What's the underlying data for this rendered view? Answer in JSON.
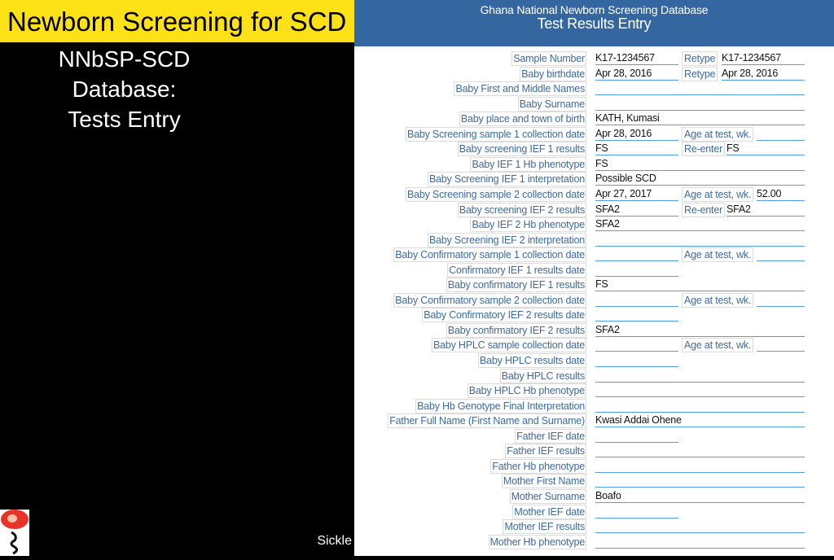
{
  "slide": {
    "title": "Newborn Screening for SCD",
    "subtitle_lines": [
      "NNbSP-SCD",
      "Database:",
      "Tests Entry"
    ],
    "footer_text": "Sickle",
    "logo_icon": "sickle-cell-logo-icon"
  },
  "form": {
    "header": {
      "line1": "Ghana National Newborn Screening Database",
      "line2": "Test Results Entry"
    },
    "rows": [
      {
        "label": "Sample Number",
        "value": "K17-1234567",
        "width": "half",
        "extra_label": "Retype",
        "extra_value": "K17-1234567"
      },
      {
        "label": "Baby birthdate",
        "value": "Apr 28, 2016",
        "width": "half",
        "extra_label": "Retype",
        "extra_value": "Apr 28, 2016"
      },
      {
        "label": "Baby First and Middle Names",
        "value": "",
        "width": "full"
      },
      {
        "label": "Baby Surname",
        "value": "",
        "width": "full"
      },
      {
        "label": "Baby place and town of birth",
        "value": "KATH, Kumasi",
        "width": "full"
      },
      {
        "label": "Baby Screening sample 1 collection date",
        "value": "Apr 28, 2016",
        "width": "half",
        "extra_label": "Age at test, wk.",
        "extra_value": ""
      },
      {
        "label": "Baby screening IEF 1 results",
        "value": "FS",
        "width": "half",
        "extra_label": "Re-enter",
        "extra_value": "FS"
      },
      {
        "label": "Baby IEF 1 Hb phenotype",
        "value": "FS",
        "width": "full"
      },
      {
        "label": "Baby Screening IEF 1 interpretation",
        "value": "Possible SCD",
        "width": "full"
      },
      {
        "label": "Baby Screening sample 2 collection date",
        "value": "Apr 27, 2017",
        "width": "half",
        "extra_label": "Age at test, wk.",
        "extra_value": "52.00"
      },
      {
        "label": "Baby screening IEF 2 results",
        "value": "SFA2",
        "width": "half",
        "extra_label": "Re-enter",
        "extra_value": "SFA2"
      },
      {
        "label": "Baby IEF 2 Hb phenotype",
        "value": "SFA2",
        "width": "full"
      },
      {
        "label": "Baby Screening IEF 2 interpretation",
        "value": "",
        "width": "full"
      },
      {
        "label": "Baby Confirmatory sample 1 collection date",
        "value": "",
        "width": "half",
        "extra_label": "Age at test, wk.",
        "extra_value": ""
      },
      {
        "label": "Confirmatory IEF 1 results date",
        "value": "",
        "width": "half"
      },
      {
        "label": "Baby confirmatory IEF 1 results",
        "value": "FS",
        "width": "full"
      },
      {
        "label": "Baby Confirmatory sample 2 collection date",
        "value": "",
        "width": "half",
        "extra_label": "Age at test, wk.",
        "extra_value": ""
      },
      {
        "label": "Baby Confirmatory IEF 2 results date",
        "value": "",
        "width": "half"
      },
      {
        "label": "Baby confirmatory IEF 2 results",
        "value": "SFA2",
        "width": "full"
      },
      {
        "label": "Baby HPLC sample collection date",
        "value": "",
        "width": "half",
        "extra_label": "Age at test, wk.",
        "extra_value": ""
      },
      {
        "label": "Baby HPLC results date",
        "value": "",
        "width": "half"
      },
      {
        "label": "Baby HPLC results",
        "value": "",
        "width": "full"
      },
      {
        "label": "Baby HPLC Hb phenotype",
        "value": "",
        "width": "full"
      },
      {
        "label": "Baby Hb Genotype Final Interpretation",
        "value": "",
        "width": "full"
      },
      {
        "label": "Father Full Name (First Name and Surname)",
        "value": "Kwasi Addai Ohene",
        "width": "full"
      },
      {
        "label": "Father IEF date",
        "value": "",
        "width": "half"
      },
      {
        "label": "Father IEF results",
        "value": "",
        "width": "full"
      },
      {
        "label": "Father Hb phenotype",
        "value": "",
        "width": "full"
      },
      {
        "label": "Mother First Name",
        "value": "",
        "width": "full"
      },
      {
        "label": "Mother Surname",
        "value": "Boafo",
        "width": "full"
      },
      {
        "label": "Mother IEF date",
        "value": "",
        "width": "half"
      },
      {
        "label": "Mother IEF results",
        "value": "",
        "width": "full"
      },
      {
        "label": "Mother Hb phenotype",
        "value": "",
        "width": "full"
      }
    ]
  }
}
